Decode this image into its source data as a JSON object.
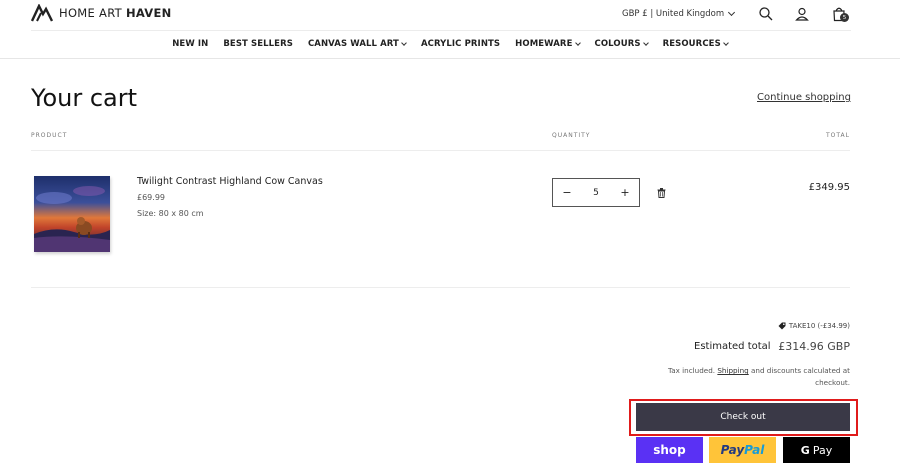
{
  "header": {
    "logo_light": "HOME ART ",
    "logo_bold": "HAVEN",
    "currency": "GBP £ | United Kingdom",
    "cart_count": "5"
  },
  "nav": {
    "items": [
      {
        "label": "NEW IN",
        "dropdown": false
      },
      {
        "label": "BEST SELLERS",
        "dropdown": false
      },
      {
        "label": "CANVAS WALL ART",
        "dropdown": true
      },
      {
        "label": "ACRYLIC PRINTS",
        "dropdown": false
      },
      {
        "label": "HOMEWARE",
        "dropdown": true
      },
      {
        "label": "COLOURS",
        "dropdown": true
      },
      {
        "label": "RESOURCES",
        "dropdown": true
      }
    ]
  },
  "cart": {
    "title": "Your cart",
    "continue_link": "Continue shopping",
    "columns": {
      "product": "PRODUCT",
      "quantity": "QUANTITY",
      "total": "TOTAL"
    },
    "item": {
      "name": "Twilight Contrast Highland Cow Canvas",
      "price": "£69.99",
      "size": "Size: 80 x 80 cm",
      "quantity": "5",
      "minus": "−",
      "plus": "+",
      "total": "£349.95"
    }
  },
  "summary": {
    "discount": "TAKE10 (-£34.99)",
    "estimated_label": "Estimated total",
    "estimated_value": "£314.96 GBP",
    "tax_prefix": "Tax included. ",
    "tax_link": "Shipping",
    "tax_suffix": " and discounts calculated at checkout.",
    "checkout_label": "Check out"
  },
  "payments": {
    "shop": "shop",
    "paypal_1": "Pay",
    "paypal_2": "Pal",
    "gpay_g": "G",
    "gpay_label": "Pay"
  },
  "colors": {
    "checkout_bg": "#3a3947",
    "highlight_outline": "#e01b1b",
    "shop_pay": "#5a31f4",
    "paypal": "#ffc439",
    "gpay": "#000000"
  },
  "icons": [
    "logo-mark-icon",
    "chevron-down-icon",
    "search-icon",
    "account-icon",
    "cart-bag-icon",
    "trash-icon",
    "discount-tag-icon"
  ]
}
